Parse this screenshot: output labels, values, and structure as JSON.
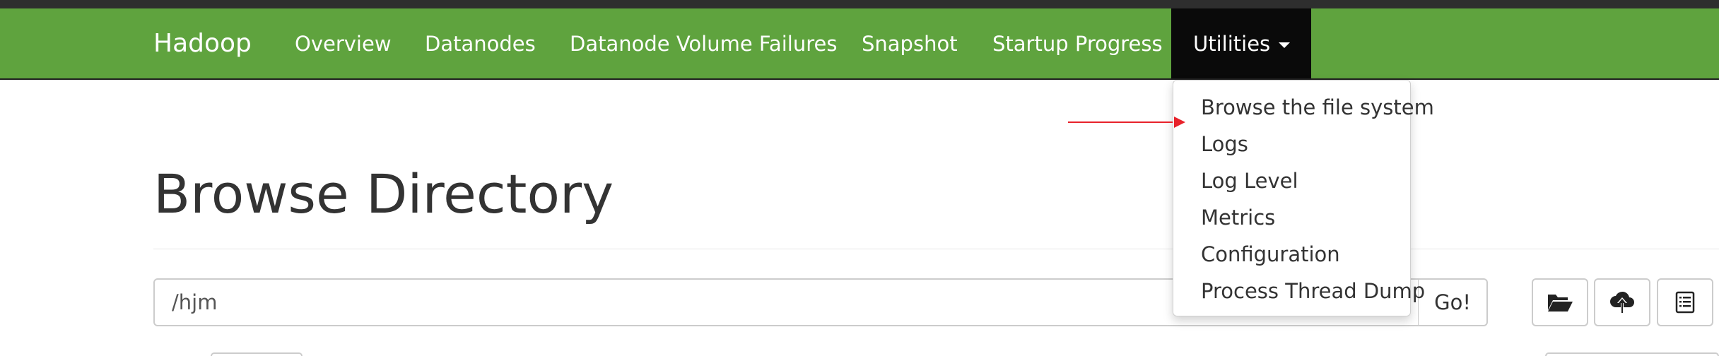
{
  "navbar": {
    "brand": "Hadoop",
    "items": [
      {
        "label": "Overview"
      },
      {
        "label": "Datanodes"
      },
      {
        "label": "Datanode Volume Failures"
      },
      {
        "label": "Snapshot"
      },
      {
        "label": "Startup Progress"
      }
    ],
    "utilities_label": "Utilities",
    "colors": {
      "background": "#5fa33e",
      "active": "#0a0a0a"
    }
  },
  "utilities_menu": {
    "items": [
      {
        "label": "Browse the file system"
      },
      {
        "label": "Logs"
      },
      {
        "label": "Log Level"
      },
      {
        "label": "Metrics"
      },
      {
        "label": "Configuration"
      },
      {
        "label": "Process Thread Dump"
      }
    ]
  },
  "annotation": {
    "arrow_color": "#e8222b",
    "icon": "arrow-right-icon"
  },
  "main": {
    "title": "Browse Directory",
    "path_value": "/hjm",
    "go_label": "Go!",
    "toolbar_icons": [
      "folder-open-icon",
      "cloud-upload-icon",
      "list-icon"
    ]
  }
}
